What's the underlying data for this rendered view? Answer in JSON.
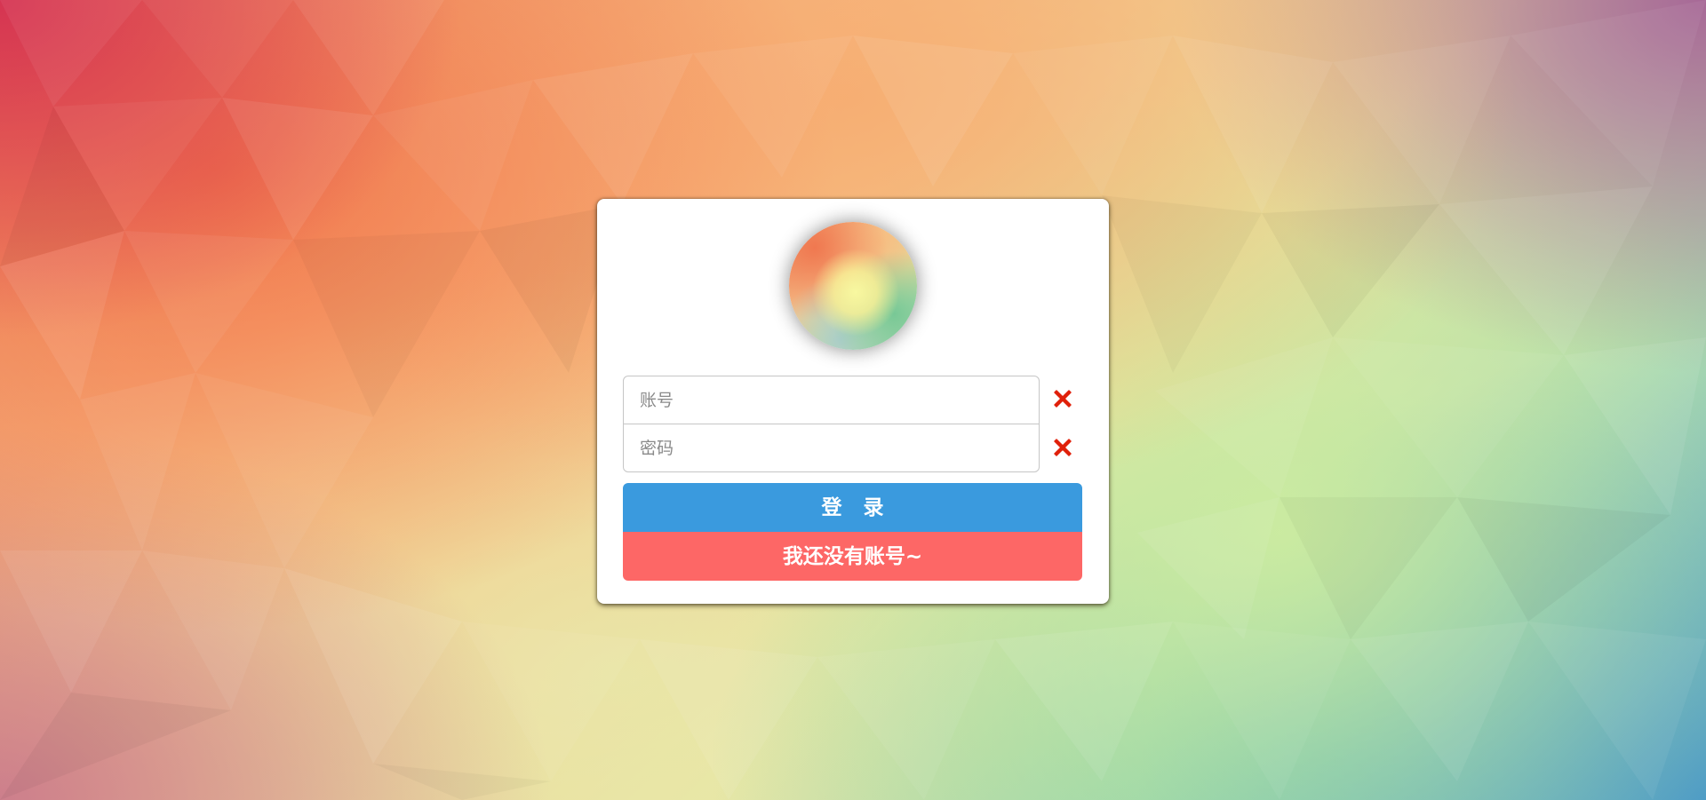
{
  "login_form": {
    "account_input": {
      "value": "",
      "placeholder": "账号"
    },
    "password_input": {
      "value": "",
      "placeholder": "密码"
    },
    "clear_icon": "close-x-icon",
    "login_button_label": "登 录",
    "register_button_label": "我还没有账号~"
  },
  "colors": {
    "login_button": "#3a9ade",
    "register_button": "#fd6766",
    "clear_icon": "#e0200a",
    "card": "#ffffff"
  }
}
